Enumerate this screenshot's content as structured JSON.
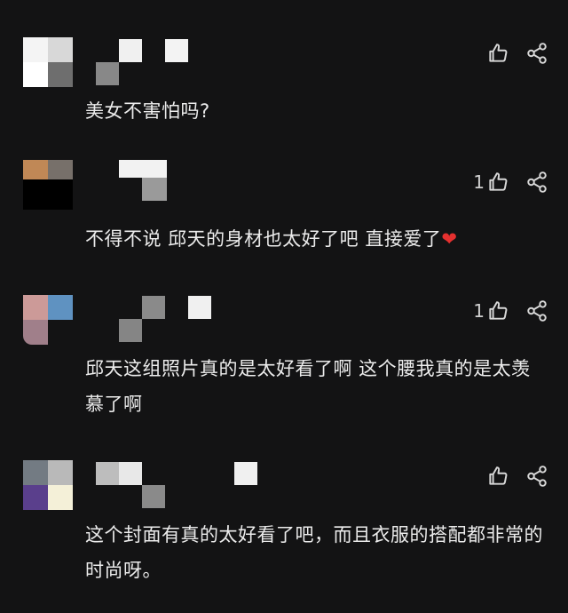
{
  "comments": [
    {
      "text": "美女不害怕吗?",
      "likes": "",
      "avatar_colors": [
        "#f4f4f4",
        "#d8d8d8",
        "#ffffff",
        "#6e6e6e"
      ]
    },
    {
      "text": "不得不说 邱天的身材也太好了吧 直接爱了",
      "emoji": "❤",
      "likes": "1",
      "avatar_colors": [
        "#c08856",
        "#77706a",
        "#000000",
        "#000000"
      ]
    },
    {
      "text": "邱天这组照片真的是太好看了啊 这个腰我真的是太羡慕了啊",
      "likes": "1",
      "avatar_colors": [
        "#cc9a98",
        "#5f92c1",
        "#a07f8a",
        "#131314"
      ]
    },
    {
      "text": "这个封面有真的太好看了吧，而且衣服的搭配都非常的时尚呀。",
      "likes": "",
      "avatar_colors": [
        "#737b83",
        "#b9b9b9",
        "#5a3f8c",
        "#f4f0d8"
      ]
    }
  ],
  "icons": {
    "like": "thumbs-up-icon",
    "share": "share-icon",
    "heart": "heart-emoji"
  }
}
